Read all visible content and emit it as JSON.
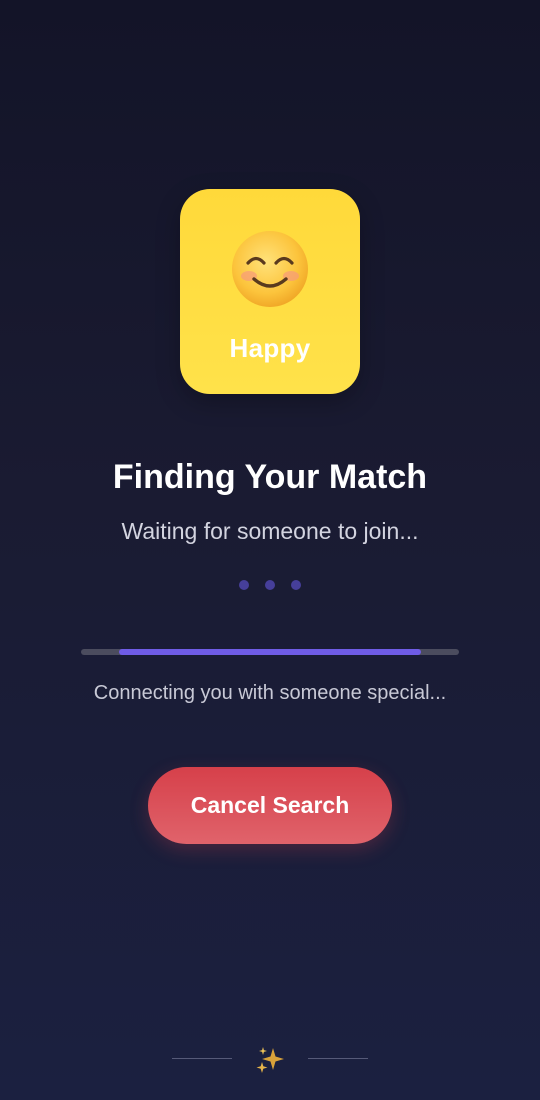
{
  "mood_card": {
    "label": "Happy",
    "emoji_icon": "smiling-face-icon",
    "color": "#ffdd3f"
  },
  "heading": {
    "title": "Finding Your Match",
    "subtitle": "Waiting for someone to join..."
  },
  "loading_dots": {
    "count": 3,
    "color": "#463f9a"
  },
  "progress": {
    "start_fraction": 0.1,
    "end_fraction": 0.9,
    "fill_color": "#6f5ce6",
    "status_text": "Connecting you with someone special..."
  },
  "cancel_button": {
    "label": "Cancel Search",
    "color": "#d94550"
  },
  "footer": {
    "icon": "sparkles-icon"
  }
}
